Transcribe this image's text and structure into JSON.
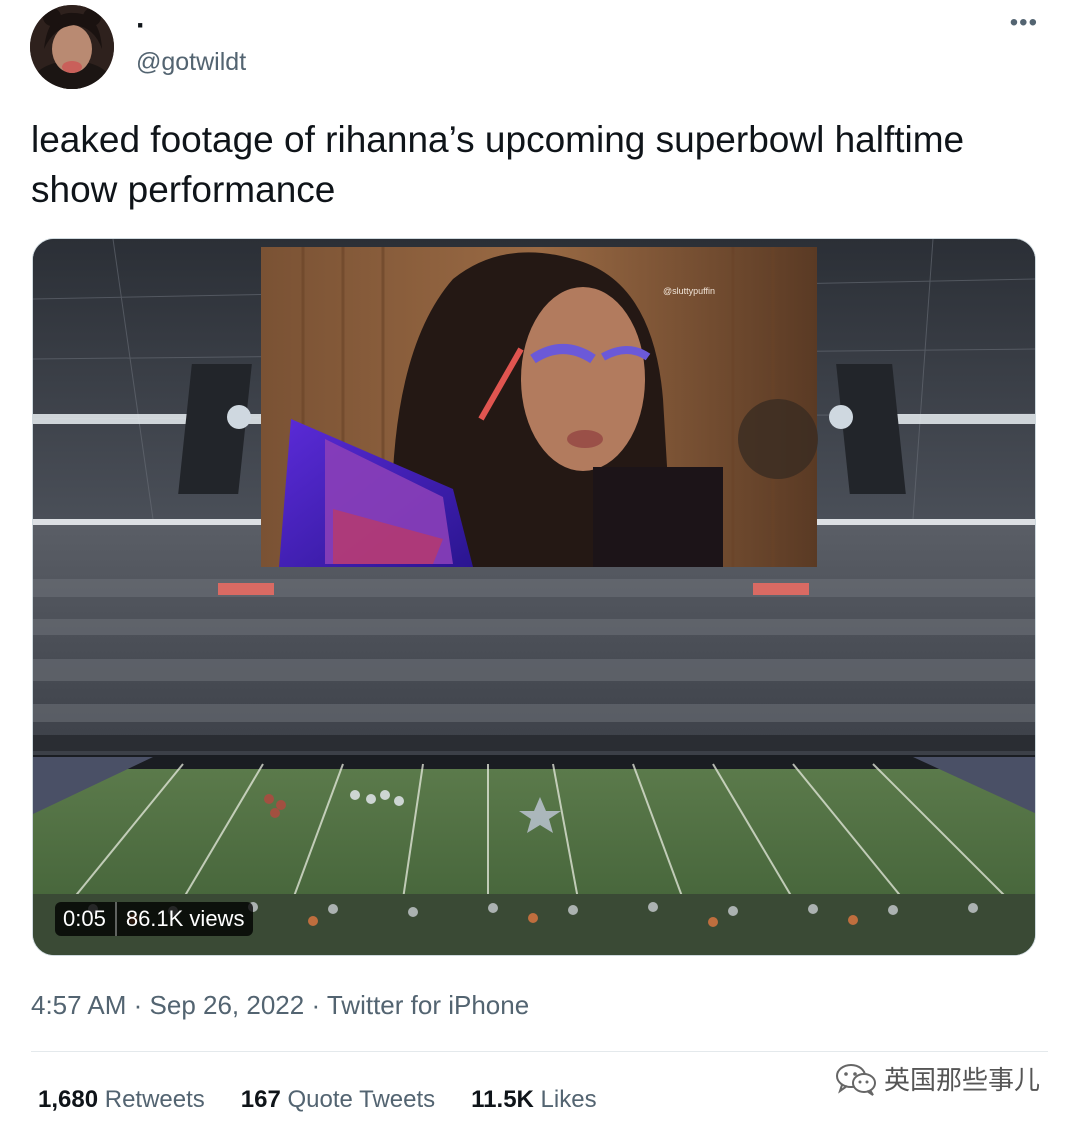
{
  "author": {
    "display_name": "·",
    "handle": "@gotwildt"
  },
  "tweet": {
    "text": "leaked footage of rihanna’s upcoming superbowl halftime show performance"
  },
  "media": {
    "overlay_credit": "@sluttypuffin",
    "video_time": "0:05",
    "views": "86.1K views"
  },
  "meta": {
    "time": "4:57 AM",
    "date": "Sep 26, 2022",
    "source": "Twitter for iPhone",
    "separator": " · "
  },
  "stats": {
    "retweets_count": "1,680",
    "retweets_label": "Retweets",
    "quotes_count": "167",
    "quotes_label": "Quote Tweets",
    "likes_count": "11.5K",
    "likes_label": "Likes"
  },
  "watermark": {
    "text": "英国那些事儿"
  },
  "icons": {
    "more": "more-horizontal-icon",
    "watermark": "wechat-icon"
  },
  "colors": {
    "text_primary": "#0f1419",
    "text_secondary": "#536471",
    "divider": "#e4e9ec",
    "field_green": "#4b6a40"
  }
}
